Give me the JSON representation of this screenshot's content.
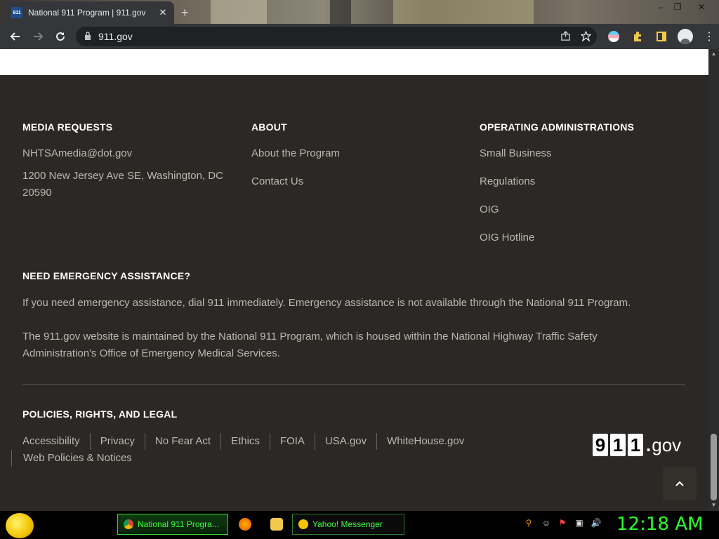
{
  "browser": {
    "tab_title": "National 911 Program | 911.gov",
    "favicon_text": "911",
    "address": "911.gov"
  },
  "footer": {
    "media": {
      "heading": "MEDIA REQUESTS",
      "email": "NHTSAmedia@dot.gov",
      "address": "1200 New Jersey Ave SE, Washington, DC 20590"
    },
    "about": {
      "heading": "ABOUT",
      "links": [
        "About the Program",
        "Contact Us"
      ]
    },
    "operating": {
      "heading": "OPERATING ADMINISTRATIONS",
      "links": [
        "Small Business",
        "Regulations",
        "OIG",
        "OIG Hotline"
      ]
    },
    "emergency": {
      "heading": "NEED EMERGENCY ASSISTANCE?",
      "text1": "If you need emergency assistance, dial 911 immediately. Emergency assistance is not available through the National 911 Program.",
      "text2": "The 911.gov website is maintained by the National 911 Program, which is housed within the National Highway Traffic Safety Administration's Office of Emergency Medical Services."
    },
    "legal": {
      "heading": "POLICIES, RIGHTS, AND LEGAL",
      "links": [
        "Accessibility",
        "Privacy",
        "No Fear Act",
        "Ethics",
        "FOIA",
        "USA.gov",
        "WhiteHouse.gov",
        "Web Policies & Notices"
      ]
    },
    "logo": {
      "d1": "9",
      "d2": "1",
      "d3": "1",
      "dot": ".",
      "suffix": "gov"
    }
  },
  "taskbar": {
    "tasks": [
      "National 911 Progra...",
      "Yahoo! Messenger"
    ],
    "clock": "12:18 AM"
  },
  "colors": {
    "footer_bg": "#2b2825",
    "heading": "#ffffff",
    "text": "#bdb7b0",
    "clock": "#2aff2a"
  }
}
